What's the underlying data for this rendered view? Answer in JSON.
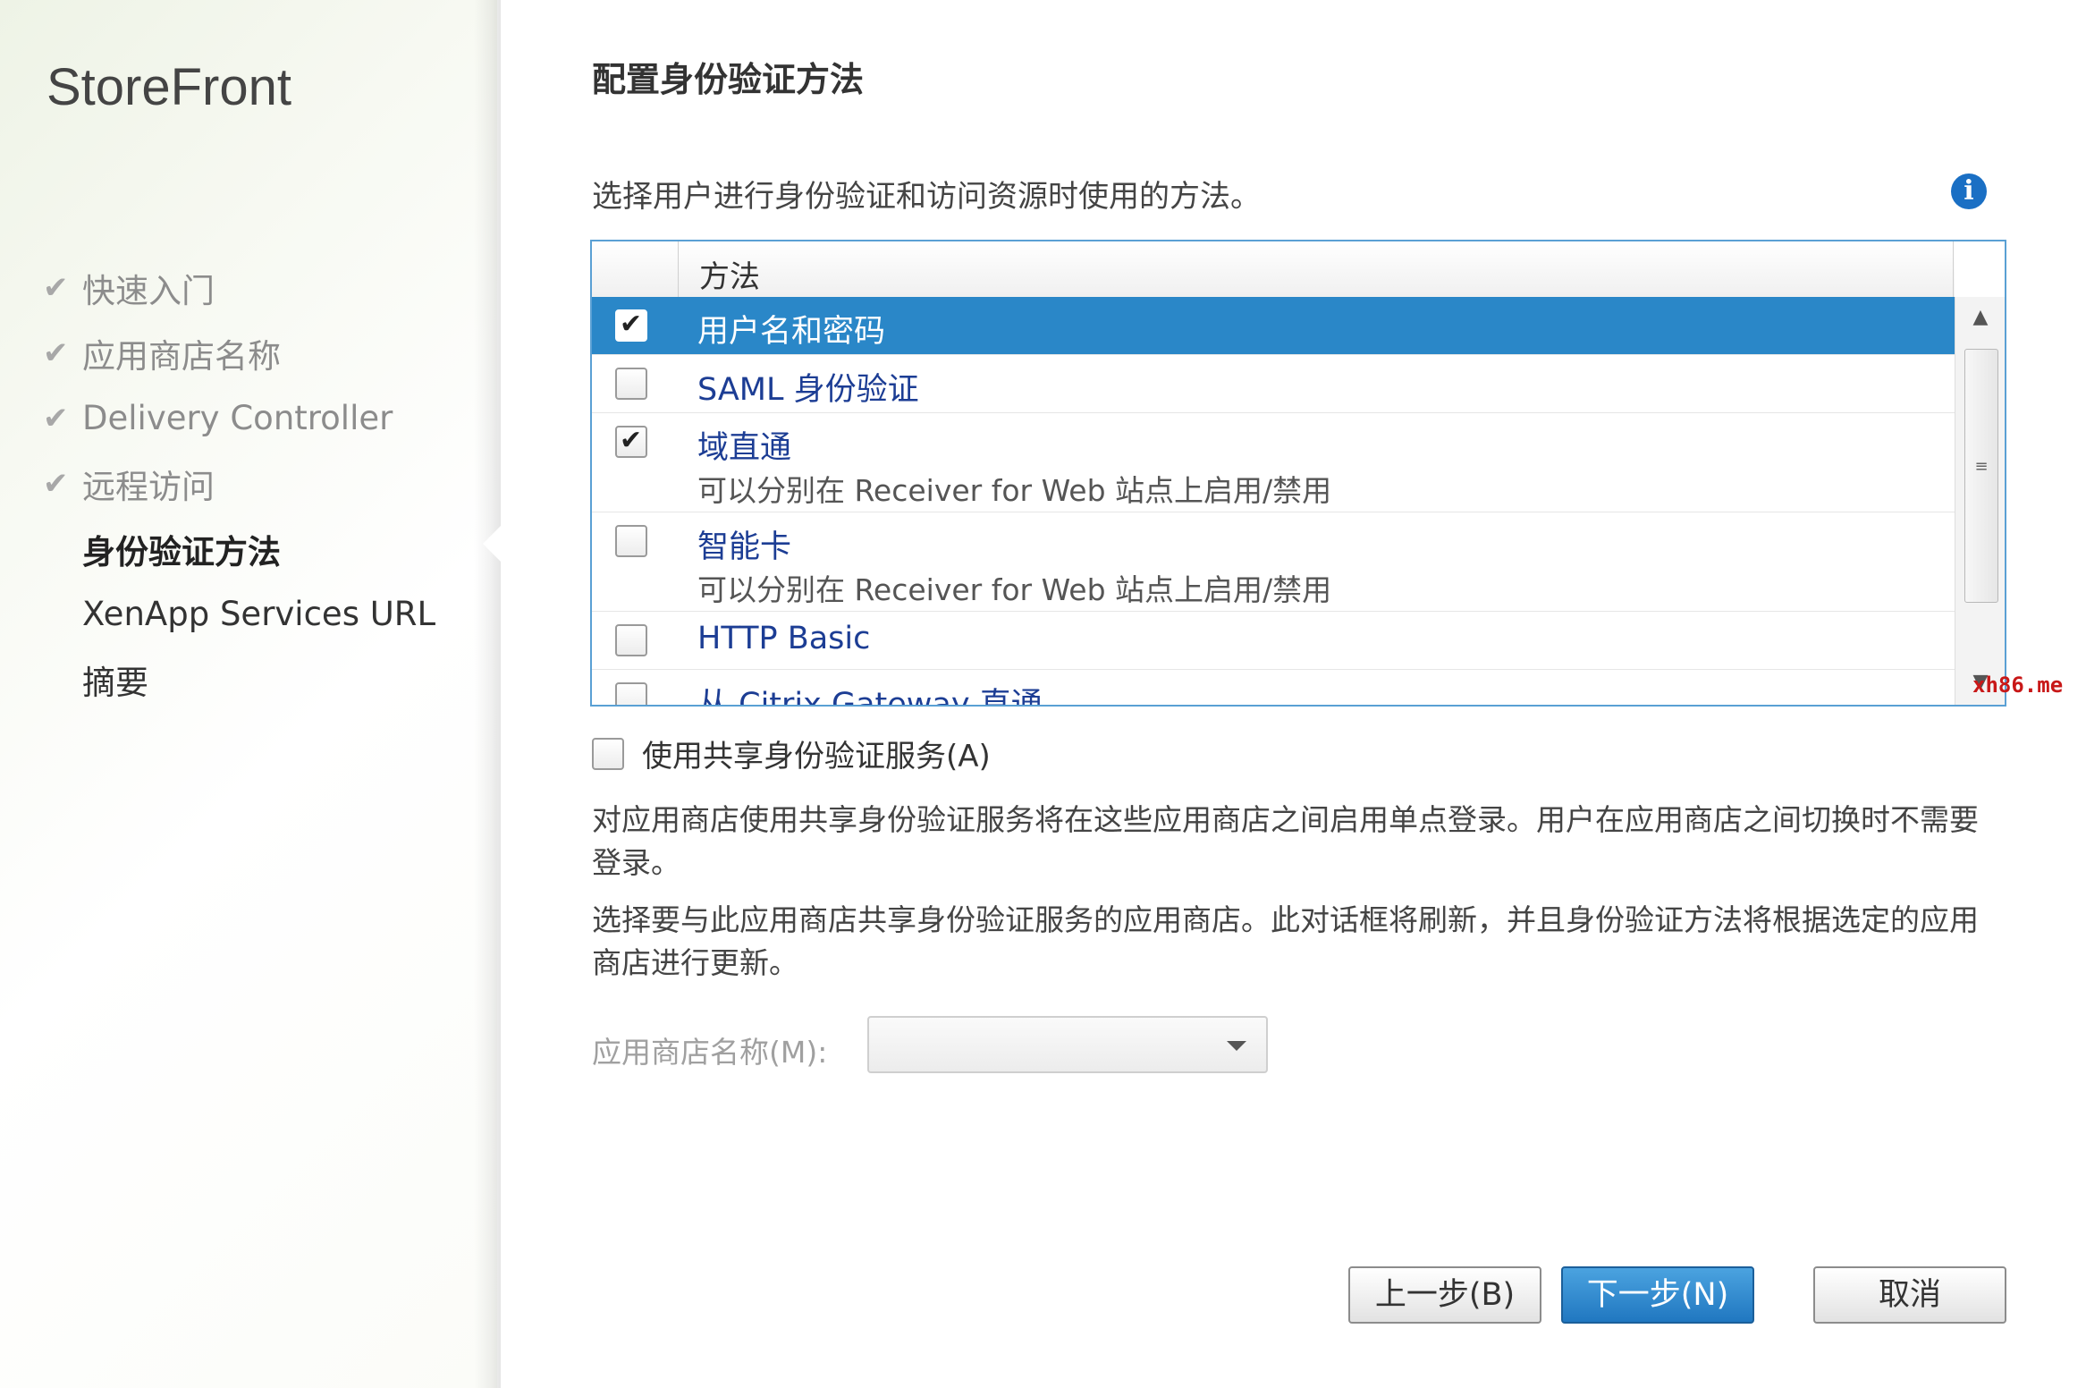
{
  "sidebar": {
    "product_title": "StoreFront",
    "steps": [
      {
        "label": "快速入门",
        "status": "done"
      },
      {
        "label": "应用商店名称",
        "status": "done"
      },
      {
        "label": "Delivery Controller",
        "status": "done"
      },
      {
        "label": "远程访问",
        "status": "done"
      },
      {
        "label": "身份验证方法",
        "status": "current"
      },
      {
        "label": "XenApp Services URL",
        "status": "upcoming"
      },
      {
        "label": "摘要",
        "status": "upcoming"
      }
    ]
  },
  "main": {
    "title": "配置身份验证方法",
    "instruction": "选择用户进行身份验证和访问资源时使用的方法。",
    "info_icon": "i",
    "methods_grid": {
      "column_header": "方法",
      "rows": [
        {
          "name": "用户名和密码",
          "checked": true,
          "selected": true,
          "description": ""
        },
        {
          "name": "SAML 身份验证",
          "checked": false,
          "selected": false,
          "description": ""
        },
        {
          "name": "域直通",
          "checked": true,
          "selected": false,
          "description": "可以分别在 Receiver for Web 站点上启用/禁用"
        },
        {
          "name": "智能卡",
          "checked": false,
          "selected": false,
          "description": "可以分别在 Receiver for Web 站点上启用/禁用"
        },
        {
          "name": "HTTP Basic",
          "checked": false,
          "selected": false,
          "description": ""
        },
        {
          "name": "从 Citrix Gateway 直通",
          "checked": false,
          "selected": false,
          "description": ""
        }
      ]
    },
    "shared_auth": {
      "label": "使用共享身份验证服务(A)",
      "checked": false
    },
    "paragraph_1": "对应用商店使用共享身份验证服务将在这些应用商店之间启用单点登录。用户在应用商店之间切换时不需要登录。",
    "paragraph_2": "选择要与此应用商店共享身份验证服务的应用商店。此对话框将刷新，并且身份验证方法将根据选定的应用商店进行更新。",
    "store_name_label": "应用商店名称(M):",
    "store_name_value": ""
  },
  "buttons": {
    "back": "上一步(B)",
    "next": "下一步(N)",
    "cancel": "取消"
  },
  "watermark": "xh86.me",
  "colors": {
    "accent": "#2a87c8",
    "link_text": "#1c3d94",
    "info_icon": "#1a6fc4",
    "watermark": "#c81818"
  }
}
